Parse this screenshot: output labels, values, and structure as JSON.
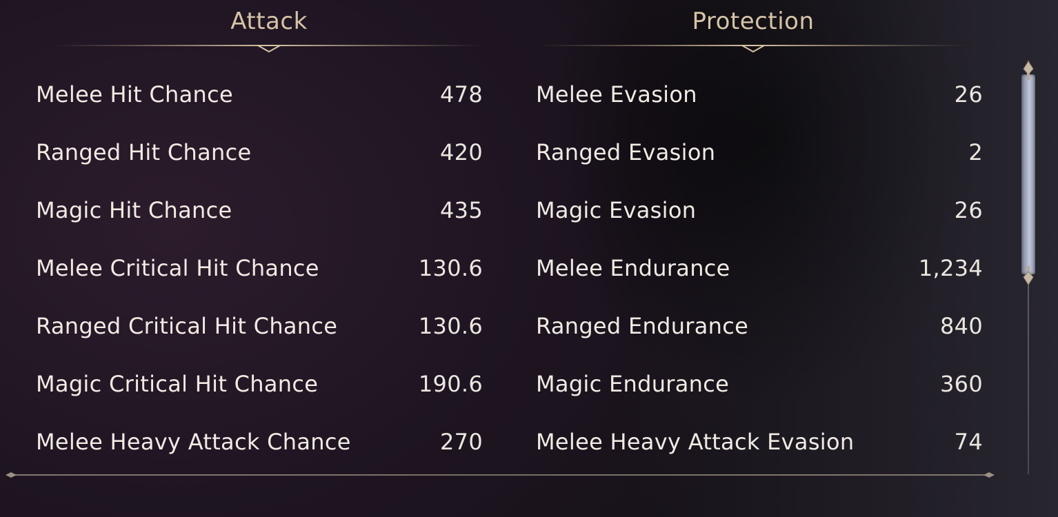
{
  "attack": {
    "title": "Attack",
    "stats": [
      {
        "label": "Melee Hit Chance",
        "value": "478"
      },
      {
        "label": "Ranged Hit Chance",
        "value": "420"
      },
      {
        "label": "Magic Hit Chance",
        "value": "435"
      },
      {
        "label": "Melee Critical Hit Chance",
        "value": "130.6"
      },
      {
        "label": "Ranged Critical Hit Chance",
        "value": "130.6"
      },
      {
        "label": "Magic Critical Hit Chance",
        "value": "190.6"
      },
      {
        "label": "Melee Heavy Attack Chance",
        "value": "270"
      }
    ]
  },
  "protection": {
    "title": "Protection",
    "stats": [
      {
        "label": "Melee Evasion",
        "value": "26"
      },
      {
        "label": "Ranged Evasion",
        "value": "2"
      },
      {
        "label": "Magic Evasion",
        "value": "26"
      },
      {
        "label": "Melee Endurance",
        "value": "1,234"
      },
      {
        "label": "Ranged Endurance",
        "value": "840"
      },
      {
        "label": "Magic Endurance",
        "value": "360"
      },
      {
        "label": "Melee Heavy Attack Evasion",
        "value": "74"
      }
    ]
  },
  "scrollbar": {
    "thumb_fraction": 0.5,
    "scroll_position": 0
  },
  "colors": {
    "header_text": "#d6c4a8",
    "stat_text": "#f1ebe4",
    "gold_rule": "#b9a282",
    "scroll_thumb": "#a8aec6",
    "background": "#1f1522"
  }
}
